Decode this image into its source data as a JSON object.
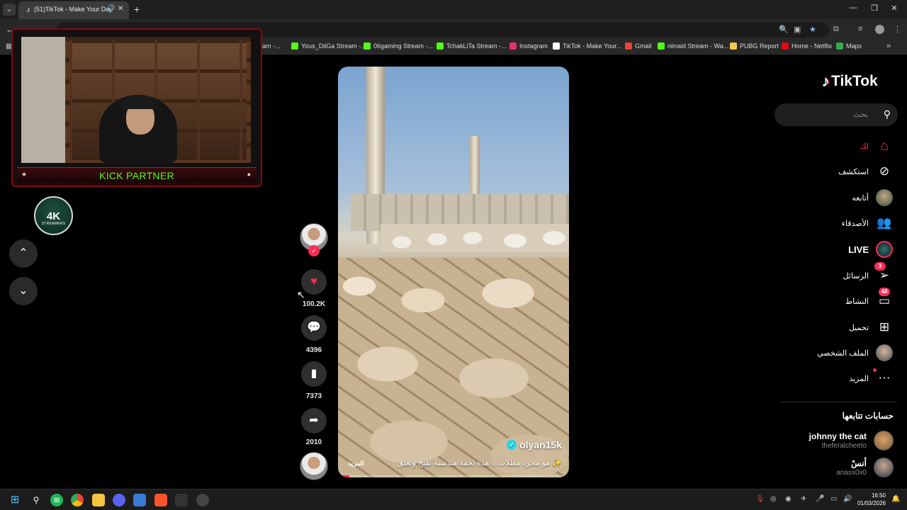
{
  "browser": {
    "tab_title": "(51)TikTok - Make Your Day",
    "new_tab_glyph": "+",
    "bookmarks": [
      {
        "label": "ream -...",
        "color": "#53fc18"
      },
      {
        "label": "Yous_DiiGa Stream -...",
        "color": "#53fc18"
      },
      {
        "label": "06gaming Stream -...",
        "color": "#53fc18"
      },
      {
        "label": "TchakLiTa Stream -...",
        "color": "#53fc18"
      },
      {
        "label": "Instagram",
        "color": "#e1306c"
      },
      {
        "label": "TikTok - Make Your...",
        "color": "#ffffff"
      },
      {
        "label": "Gmail",
        "color": "#ea4335"
      },
      {
        "label": "niinaid Stream - Wa...",
        "color": "#53fc18"
      },
      {
        "label": "PUBG Report",
        "color": "#f2c94c"
      },
      {
        "label": "Home - Netflix",
        "color": "#e50914"
      },
      {
        "label": "Maps",
        "color": "#34a853"
      }
    ]
  },
  "overlay": {
    "partner_label": "KICK PARTNER",
    "logo_text": "4K",
    "logo_subtext": "STREAMERS"
  },
  "video": {
    "author": "olyan15k",
    "caption": "✨ مو مجرد مظلات... هذه تحفة هندسية تفتح وتغلق",
    "more_label": "المزيد",
    "progress": 0.05
  },
  "actions": {
    "likes": "100.2K",
    "comments": "4396",
    "saves": "7373",
    "shares": "2010"
  },
  "sidebar": {
    "brand": "TikTok",
    "search_placeholder": "بحث",
    "items": [
      {
        "label": "لك",
        "icon": "home-icon",
        "active": true
      },
      {
        "label": "استكشف",
        "icon": "compass-icon"
      },
      {
        "label": "أتابعه",
        "icon": "following-avatar"
      },
      {
        "label": "الأصدقاء",
        "icon": "friends-icon"
      },
      {
        "label": "LIVE",
        "icon": "live-avatar"
      },
      {
        "label": "الرسائل",
        "icon": "messages-icon",
        "badge": "3"
      },
      {
        "label": "النشاط",
        "icon": "activity-icon",
        "badge": "48"
      },
      {
        "label": "تحميل",
        "icon": "upload-icon"
      },
      {
        "label": "الملف الشخصي",
        "icon": "profile-avatar"
      },
      {
        "label": "المزيد",
        "icon": "more-icon"
      }
    ],
    "following_heading": "حسابات تتابعها",
    "following": [
      {
        "name": "johnny the cat",
        "handle": "theferalcheeto"
      },
      {
        "name": "أنسْ",
        "handle": "anass0x0"
      }
    ]
  },
  "taskbar": {
    "time": "16:50",
    "date": "01/03/2026"
  },
  "colors": {
    "accent": "#fe2c55",
    "kick_green": "#53fc18",
    "verified": "#20d5ec"
  }
}
